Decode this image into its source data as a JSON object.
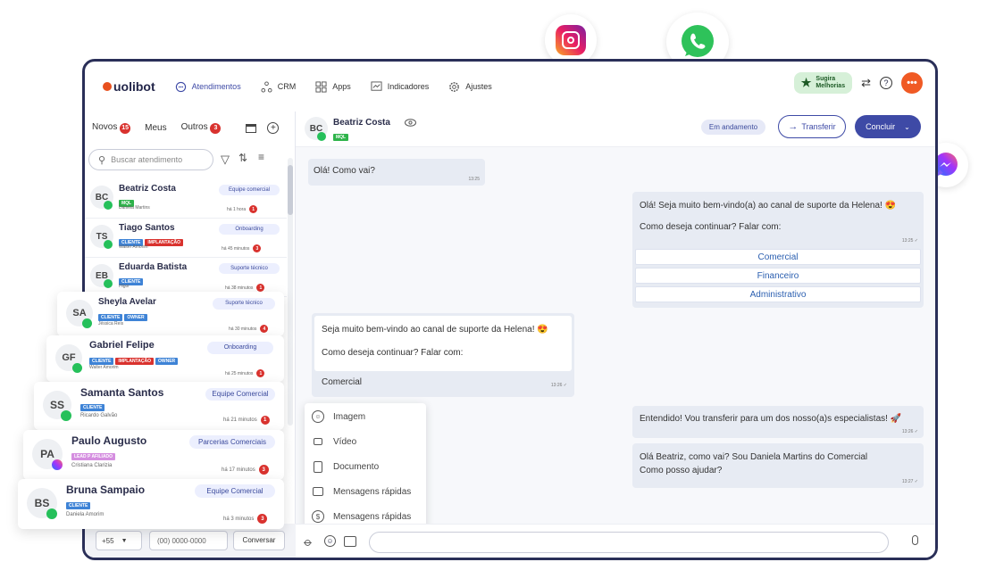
{
  "app": {
    "logo": "uolibot"
  },
  "nav": [
    {
      "label": "Atendimentos",
      "icon": "chat-bubble-icon",
      "active": true
    },
    {
      "label": "CRM",
      "icon": "crm-nodes-icon"
    },
    {
      "label": "Apps",
      "icon": "grid-icon"
    },
    {
      "label": "Indicadores",
      "icon": "chart-icon"
    },
    {
      "label": "Ajustes",
      "icon": "gear-icon"
    }
  ],
  "top_right": {
    "suggest_line1": "Sugira",
    "suggest_line2": "Melhorias"
  },
  "left": {
    "tabs": [
      {
        "label": "Novos",
        "count": "15"
      },
      {
        "label": "Meus"
      },
      {
        "label": "Outros",
        "count": "3"
      }
    ],
    "search_placeholder": "Buscar atendimento",
    "conversations": [
      {
        "initials": "BC",
        "name": "Beatriz Costa",
        "tags": [
          "MQL"
        ],
        "agent": "Daniela Martins",
        "queue": "Equipe comercial",
        "time": "há 1 hora",
        "count": "1"
      },
      {
        "initials": "TS",
        "name": "Tiago Santos",
        "tags": [
          "CLIENTE",
          "IMPLANTAÇÃO"
        ],
        "agent": "Walter Amorim",
        "queue": "Onboarding",
        "time": "há 45 minutos",
        "count": "3"
      },
      {
        "initials": "EB",
        "name": "Eduarda Batista",
        "tags": [
          "CLIENTE"
        ],
        "agent": "Higor",
        "queue": "Suporte técnico",
        "time": "há 38 minutos",
        "count": "1"
      }
    ],
    "cards": [
      {
        "initials": "SA",
        "name": "Sheyla Avelar",
        "tags": [
          "CLIENTE",
          "OWNER"
        ],
        "agent": "Jéssica Reis",
        "queue": "Suporte técnico",
        "time": "há 30 minutos",
        "count": "4"
      },
      {
        "initials": "GF",
        "name": "Gabriel Felipe",
        "tags": [
          "CLIENTE",
          "IMPLANTAÇÃO",
          "OWNER"
        ],
        "agent": "Walter Amorim",
        "queue": "Onboarding",
        "time": "há 25 minutos",
        "count": "1"
      },
      {
        "initials": "SS",
        "name": "Samanta Santos",
        "tags": [
          "CLIENTE"
        ],
        "agent": "Ricardo Galvão",
        "queue": "Equipe Comercial",
        "time": "há 21 minutos",
        "count": "1"
      },
      {
        "initials": "PA",
        "name": "Paulo Augusto",
        "tags": [
          "LEAD P AFILIADO"
        ],
        "agent": "Cristiana Clarizia",
        "queue": "Parcerias Comerciais",
        "time": "há 17 minutos",
        "count": "3"
      },
      {
        "initials": "BS",
        "name": "Bruna Sampaio",
        "tags": [
          "CLIENTE"
        ],
        "agent": "Daniela Amorim",
        "queue": "Equipe Comercial",
        "time": "há 3 minutos",
        "count": "3"
      }
    ],
    "bottom": {
      "country_code": "+55",
      "phone_placeholder": "(00) 0000-0000",
      "button": "Conversar"
    }
  },
  "chat": {
    "contact_initials": "BC",
    "contact_name": "Beatriz Costa",
    "contact_tag": "MQL",
    "status": "Em andamento",
    "transfer": "Transferir",
    "conclude": "Concluir",
    "messages": {
      "m1": {
        "text": "Olá! Como vai?",
        "time": "13:25"
      },
      "m2": {
        "line1": "Olá! Seja muito bem-vindo(a) ao canal de suporte da Helena!",
        "line2": "Como deseja continuar? Falar com:",
        "time": "13:25",
        "options": [
          "Comercial",
          "Financeiro",
          "Administrativo"
        ]
      },
      "m3": {
        "line1": "Seja muito bem-vindo ao canal de suporte da Helena!",
        "line2": "Como deseja continuar? Falar com:",
        "option": "Comercial",
        "time": "13:26"
      },
      "m4": {
        "text": "Entendido! Vou transferir para um dos nosso(a)s especialistas!",
        "time": "13:26"
      },
      "m5": {
        "line1": "Olá Beatriz, como vai? Sou Daniela Martins do Comercial",
        "line2": "Como posso ajudar?",
        "time": "13:27"
      }
    },
    "attach_menu": [
      "Imagem",
      "Vídeo",
      "Documento",
      "Mensagens rápidas",
      "Mensagens rápidas"
    ]
  },
  "colors": {
    "accent": "#3e4aa6",
    "brand": "#e8501e",
    "whatsapp": "#25c05a",
    "badge_red": "#d9322e"
  }
}
